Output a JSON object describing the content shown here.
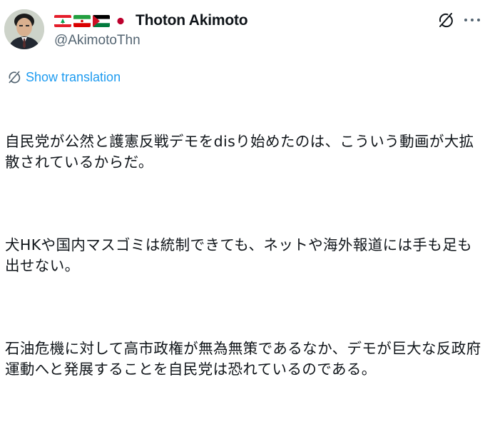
{
  "author": {
    "display_name": "Thoton Akimoto",
    "handle": "@AkimotoThn",
    "flags": [
      "lebanon-flag",
      "iran-flag",
      "palestine-flag",
      "japan-flag"
    ]
  },
  "actions": {
    "grok_icon": "grok-icon",
    "more_icon": "more-options-icon"
  },
  "translation": {
    "label": "Show translation"
  },
  "post": {
    "paragraphs": [
      "自民党が公然と護憲反戦デモをdisり始めたのは、こういう動画が大拡散されているからだ。",
      "犬HKや国内マスゴミは統制できても、ネットや海外報道には手も足も出せない。",
      "石油危機に対して高市政権が無為無策であるなか、デモが巨大な反政府運動へと発展することを自民党は恐れているのである。"
    ]
  },
  "colors": {
    "text": "#0f1419",
    "secondary": "#536471",
    "link": "#1d9bf0"
  }
}
